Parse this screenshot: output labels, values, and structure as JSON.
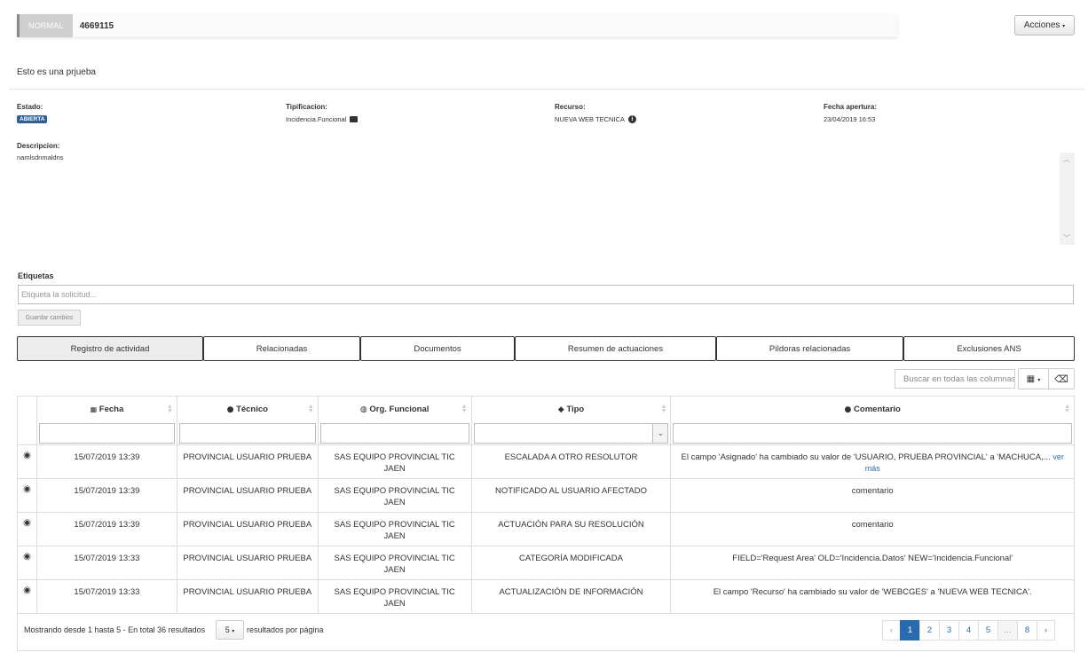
{
  "header": {
    "priority": "NORMAL",
    "ticket_id": "4669115",
    "actions_label": "Acciones"
  },
  "subject": "Esto es una prjueba",
  "fields": {
    "estado": {
      "label": "Estado:",
      "value": "ABIERTA"
    },
    "tipificacion": {
      "label": "Tipificacion:",
      "value": "Incidencia.Funcional",
      "icon": "briefcase-icon"
    },
    "recurso": {
      "label": "Recurso:",
      "value": "NUEVA WEB TECNICA",
      "icon": "info-icon"
    },
    "fecha": {
      "label": "Fecha apertura:",
      "value": "23/04/2019 16:53"
    },
    "descripcion": {
      "label": "Descripcion:",
      "value": "namlsdnmaldns"
    }
  },
  "tags": {
    "label": "Etiquetas",
    "placeholder": "Etiqueta la solicitud...",
    "save_label": "Guardar cambios"
  },
  "tabs": [
    {
      "label": "Registro de actividad",
      "active": true
    },
    {
      "label": "Relacionadas"
    },
    {
      "label": "Documentos"
    },
    {
      "label": "Resumen de actuaciones"
    },
    {
      "label": "Píldoras relacionadas"
    },
    {
      "label": "Exclusiones ANS"
    }
  ],
  "table": {
    "search_placeholder": "Buscar en todas las columnas",
    "columns": [
      {
        "label": "Fecha",
        "icon": "calendar-icon"
      },
      {
        "label": "Técnico",
        "icon": "user-icon"
      },
      {
        "label": "Org. Funcional",
        "icon": "globe-icon"
      },
      {
        "label": "Tipo",
        "icon": "tag-icon"
      },
      {
        "label": "Comentario",
        "icon": "comment-icon"
      }
    ],
    "rows": [
      {
        "fecha": "15/07/2019 13:39",
        "tecnico": "PROVINCIAL USUARIO PRUEBA",
        "org": "SAS EQUIPO PROVINCIAL TIC JAEN",
        "tipo": "ESCALADA A OTRO RESOLUTOR",
        "comentario": "El campo 'Asignado' ha cambiado su valor de 'USUARIO, PRUEBA PROVINCIAL' a 'MACHUCA,...",
        "more": "ver más"
      },
      {
        "fecha": "15/07/2019 13:39",
        "tecnico": "PROVINCIAL USUARIO PRUEBA",
        "org": "SAS EQUIPO PROVINCIAL TIC JAEN",
        "tipo": "NOTIFICADO AL USUARIO AFECTADO",
        "comentario": "comentario",
        "more": ""
      },
      {
        "fecha": "15/07/2019 13:39",
        "tecnico": "PROVINCIAL USUARIO PRUEBA",
        "org": "SAS EQUIPO PROVINCIAL TIC JAEN",
        "tipo": "ACTUACIÓN PARA SU RESOLUCIÓN",
        "comentario": "comentario",
        "more": ""
      },
      {
        "fecha": "15/07/2019 13:33",
        "tecnico": "PROVINCIAL USUARIO PRUEBA",
        "org": "SAS EQUIPO PROVINCIAL TIC JAEN",
        "tipo": "CATEGORÍA MODIFICADA",
        "comentario": "FIELD='Request Area' OLD='Incidencia.Datos' NEW='Incidencia.Funcional'",
        "more": ""
      },
      {
        "fecha": "15/07/2019 13:33",
        "tecnico": "PROVINCIAL USUARIO PRUEBA",
        "org": "SAS EQUIPO PROVINCIAL TIC JAEN",
        "tipo": "ACTUALIZACIÓN DE INFORMACIÓN",
        "comentario": "El campo 'Recurso' ha cambiado su valor de 'WEBCGES' a 'NUEVA WEB TECNICA'.",
        "more": ""
      }
    ],
    "footer": {
      "showing": "Mostrando desde 1 hasta 5 - En total 36 resultados",
      "per_page_value": "5",
      "per_page_label": "resultados por página",
      "pages": [
        "‹",
        "1",
        "2",
        "3",
        "4",
        "5",
        "...",
        "8",
        "›"
      ],
      "current_page": "1"
    }
  },
  "colors": {
    "badge": "#2d5f9a",
    "link": "#2a6bb0"
  }
}
